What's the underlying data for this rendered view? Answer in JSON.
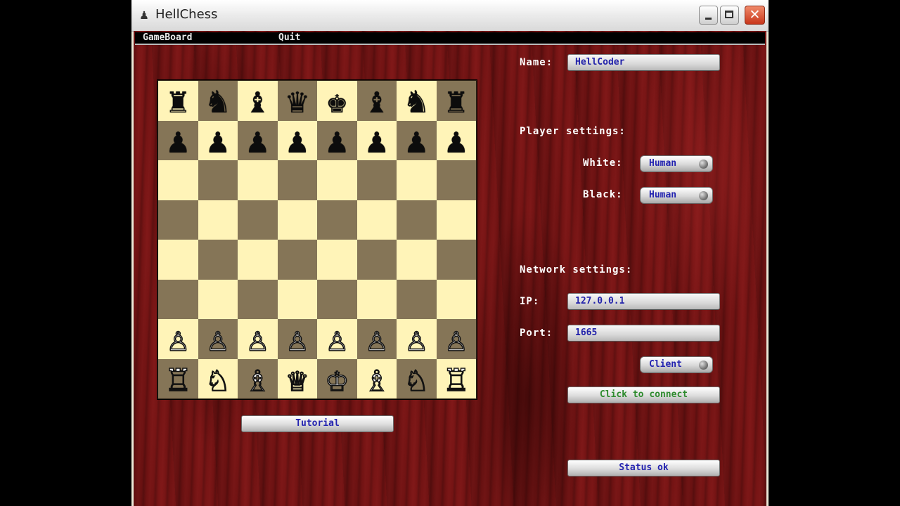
{
  "window": {
    "title": "HellChess",
    "icon": "chess-pawn-icon",
    "close_glyph": "✕"
  },
  "menu": {
    "gameboard": "GameBoard",
    "quit": "Quit"
  },
  "board": {
    "rows": [
      [
        "♜",
        "♞",
        "♝",
        "♛",
        "♚",
        "♝",
        "♞",
        "♜"
      ],
      [
        "♟",
        "♟",
        "♟",
        "♟",
        "♟",
        "♟",
        "♟",
        "♟"
      ],
      [
        "",
        "",
        "",
        "",
        "",
        "",
        "",
        ""
      ],
      [
        "",
        "",
        "",
        "",
        "",
        "",
        "",
        ""
      ],
      [
        "",
        "",
        "",
        "",
        "",
        "",
        "",
        ""
      ],
      [
        "",
        "",
        "",
        "",
        "",
        "",
        "",
        ""
      ],
      [
        "♙",
        "♙",
        "♙",
        "♙",
        "♙",
        "♙",
        "♙",
        "♙"
      ],
      [
        "♖",
        "♘",
        "♗",
        "♕",
        "♔",
        "♗",
        "♘",
        "♖"
      ]
    ],
    "colors": {
      "light": "#fff4b8",
      "dark": "#857557"
    }
  },
  "settings": {
    "name_label": "Name:",
    "name_value": "HellCoder",
    "player_settings_label": "Player settings:",
    "white_label": "White:",
    "white_value": "Human",
    "black_label": "Black:",
    "black_value": "Human",
    "network_settings_label": "Network settings:",
    "ip_label": "IP:",
    "ip_value": "127.0.0.1",
    "port_label": "Port:",
    "port_value": "1665",
    "client_value": "Client",
    "connect_label": "Click to connect",
    "tutorial_label": "Tutorial",
    "status_label": "Status ok"
  }
}
